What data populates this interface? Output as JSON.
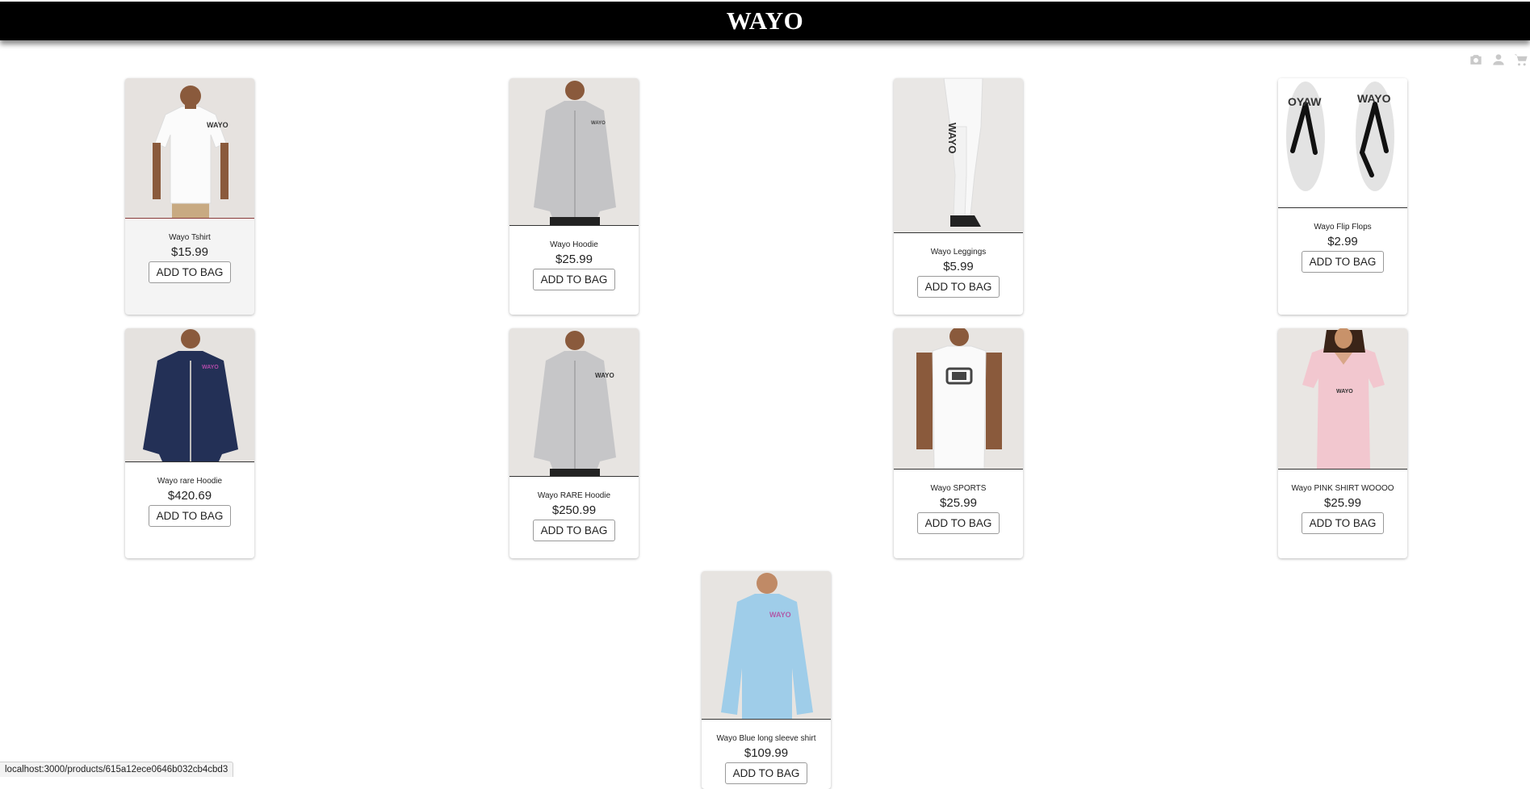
{
  "header": {
    "brand": "WAYO"
  },
  "icons": [
    "camera-icon",
    "user-icon",
    "cart-icon"
  ],
  "products": [
    {
      "name": "Wayo Tshirt",
      "price": "$15.99",
      "button": "ADD TO BAG"
    },
    {
      "name": "Wayo Hoodie",
      "price": "$25.99",
      "button": "ADD TO BAG"
    },
    {
      "name": "Wayo Leggings",
      "price": "$5.99",
      "button": "ADD TO BAG"
    },
    {
      "name": "Wayo Flip Flops",
      "price": "$2.99",
      "button": "ADD TO BAG"
    },
    {
      "name": "Wayo rare Hoodie",
      "price": "$420.69",
      "button": "ADD TO BAG"
    },
    {
      "name": "Wayo RARE Hoodie",
      "price": "$250.99",
      "button": "ADD TO BAG"
    },
    {
      "name": "Wayo SPORTS",
      "price": "$25.99",
      "button": "ADD TO BAG"
    },
    {
      "name": "Wayo PINK SHIRT WOOOO",
      "price": "$25.99",
      "button": "ADD TO BAG"
    },
    {
      "name": "Wayo Blue long sleeve shirt",
      "price": "$109.99",
      "button": "ADD TO BAG"
    }
  ],
  "image_labels": {
    "tshirt": "WAYO",
    "hoodie": "WAYO",
    "leggings": "WAYO",
    "flipflop_left": "OYAW",
    "flipflop_right": "WAYO",
    "rare_hoodie": "WAYO",
    "rare_hoodie2": "WAYO",
    "pink": "WAYO",
    "blue": "WAYO"
  },
  "status_url": "localhost:3000/products/615a12ece0646b032cb4cbd3"
}
